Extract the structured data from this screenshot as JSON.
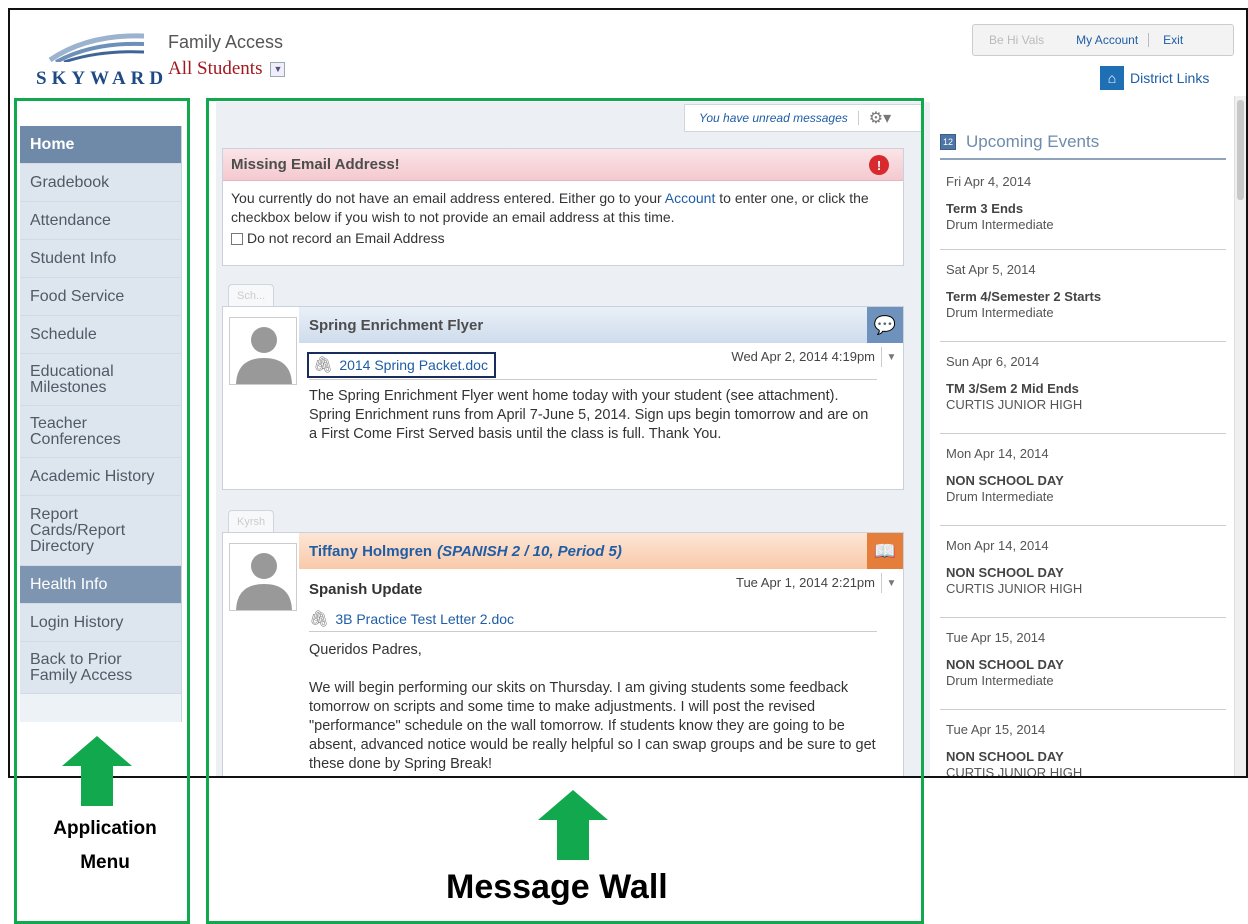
{
  "brand": {
    "logo_text": "SKYWARD",
    "title": "Family Access",
    "student_select": "All Students"
  },
  "topbar": {
    "blurred_label": "Be Hi Vals",
    "my_account": "My Account",
    "exit": "Exit",
    "district_links": "District Links"
  },
  "sidebar": {
    "items": [
      {
        "label": "Home"
      },
      {
        "label": "Gradebook"
      },
      {
        "label": "Attendance"
      },
      {
        "label": "Student Info"
      },
      {
        "label": "Food Service"
      },
      {
        "label": "Schedule"
      },
      {
        "label": "Educational Milestones"
      },
      {
        "label": "Teacher Conferences"
      },
      {
        "label": "Academic History"
      },
      {
        "label": "Report Cards/Report Directory"
      },
      {
        "label": "Health Info"
      },
      {
        "label": "Login History"
      },
      {
        "label": "Back to Prior Family Access"
      }
    ]
  },
  "wall": {
    "unread": "You have unread messages",
    "alert": {
      "title": "Missing Email Address!",
      "body_1": "You currently do not have an email address entered. Either go to your ",
      "link": "Account",
      "body_2": " to enter one, or click the checkbox below if you wish to not provide an email address at this time.",
      "checkbox_label": "Do not record an Email Address"
    },
    "msg1": {
      "tab": "Sch...",
      "title": "Spring Enrichment Flyer",
      "date": "Wed Apr 2, 2014 4:19pm",
      "attachment": "2014 Spring Packet.doc",
      "body": "The Spring Enrichment Flyer went home today with your student (see attachment). Spring Enrichment runs from April 7-June 5, 2014. Sign ups begin tomorrow and are on a First Come First Served basis until the class is full. Thank You."
    },
    "msg2": {
      "tab": "Kyrsh",
      "teacher": "Tiffany Holmgren",
      "class": "(SPANISH 2 / 10, Period 5)",
      "subject": "Spanish Update",
      "date": "Tue Apr 1, 2014 2:21pm",
      "attachment": "3B Practice Test Letter 2.doc",
      "greeting": "Queridos Padres,",
      "body": "We will begin performing our skits on Thursday. I am giving students some feedback tomorrow on scripts and some time to make adjustments. I will post the revised \"performance\" schedule on the wall tomorrow. If students know they are going to be absent, advanced notice would be really helpful so I can swap groups and be sure to get these done by Spring Break!"
    }
  },
  "events": {
    "title": "Upcoming Events",
    "list": [
      {
        "date": "Fri Apr 4, 2014",
        "title": "Term 3 Ends",
        "sub": "Drum Intermediate"
      },
      {
        "date": "Sat Apr 5, 2014",
        "title": "Term 4/Semester 2 Starts",
        "sub": "Drum Intermediate"
      },
      {
        "date": "Sun Apr 6, 2014",
        "title": "TM 3/Sem 2 Mid Ends",
        "sub": "CURTIS JUNIOR HIGH"
      },
      {
        "date": "Mon Apr 14, 2014",
        "title": "NON SCHOOL DAY",
        "sub": "Drum Intermediate"
      },
      {
        "date": "Mon Apr 14, 2014",
        "title": "NON SCHOOL DAY",
        "sub": "CURTIS JUNIOR HIGH"
      },
      {
        "date": "Tue Apr 15, 2014",
        "title": "NON SCHOOL DAY",
        "sub": "Drum Intermediate"
      },
      {
        "date": "Tue Apr 15, 2014",
        "title": "NON SCHOOL DAY",
        "sub": "CURTIS JUNIOR HIGH"
      }
    ]
  },
  "annotations": {
    "menu_line1": "Application",
    "menu_line2": "Menu",
    "wall": "Message Wall"
  },
  "colors": {
    "accent": "#1f5da6",
    "annotation": "#12a84d",
    "alert": "#d72a2e",
    "brand_red": "#a3171e"
  }
}
